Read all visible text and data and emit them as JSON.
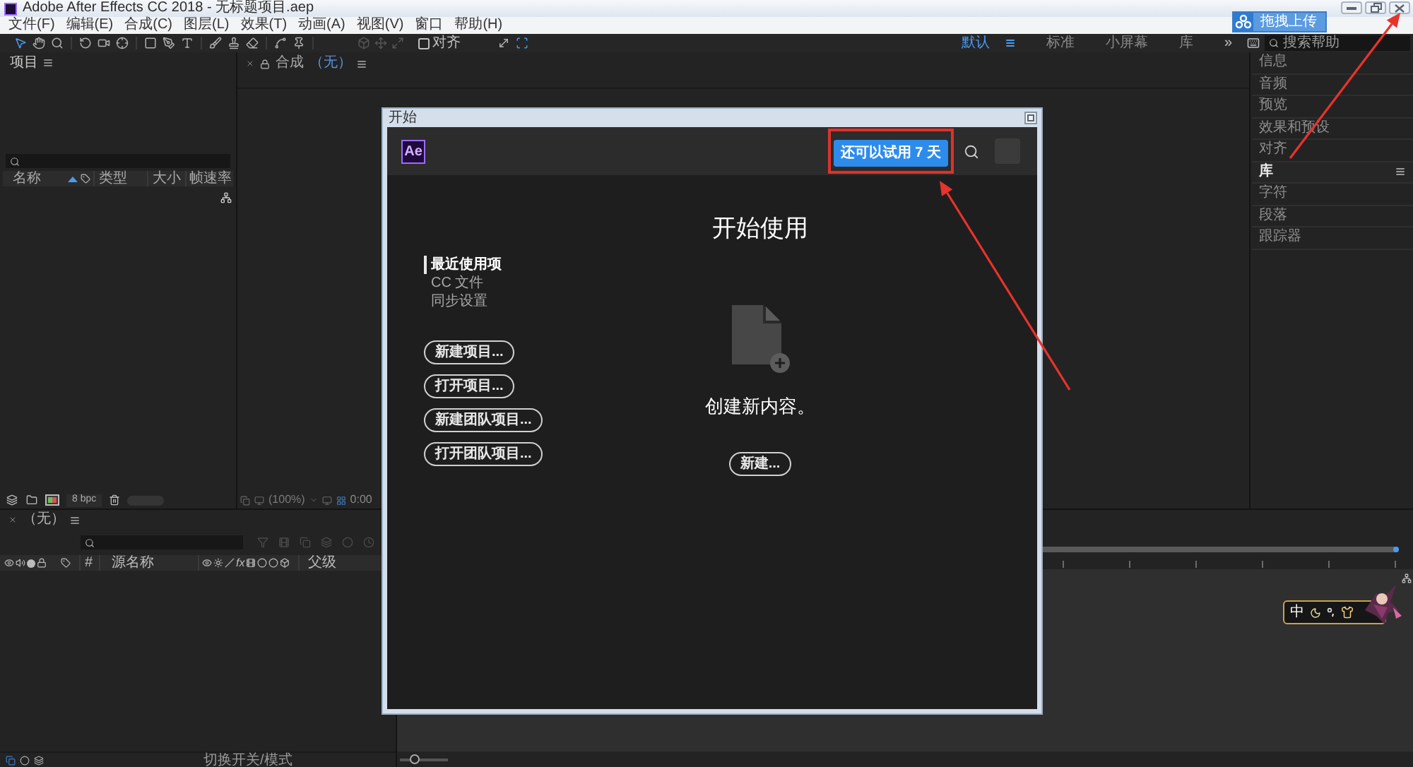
{
  "window": {
    "title": "Adobe After Effects CC 2018 - 无标题项目.aep"
  },
  "menu": [
    "文件(F)",
    "编辑(E)",
    "合成(C)",
    "图层(L)",
    "效果(T)",
    "动画(A)",
    "视图(V)",
    "窗口",
    "帮助(H)"
  ],
  "upload_overlay": {
    "label": "拖拽上传"
  },
  "toolbar": {
    "snap": {
      "label": "对齐",
      "checked": false
    },
    "workspaces": [
      {
        "label": "默认",
        "selected": true
      },
      {
        "label": "标准",
        "selected": false
      },
      {
        "label": "小屏幕",
        "selected": false
      },
      {
        "label": "库",
        "selected": false
      }
    ],
    "overflow": "»",
    "help_search": {
      "placeholder": "搜索帮助"
    }
  },
  "project_panel": {
    "title": "项目",
    "columns": [
      "名称",
      "类型",
      "大小",
      "帧速率"
    ],
    "bit_depth": "8 bpc"
  },
  "composition_panel": {
    "title": "合成",
    "comp_name": "（无）",
    "zoom": "(100%)",
    "timecode": "0:00"
  },
  "side_panels": [
    {
      "label": "信息",
      "selected": false
    },
    {
      "label": "音频",
      "selected": false
    },
    {
      "label": "预览",
      "selected": false
    },
    {
      "label": "效果和预设",
      "selected": false
    },
    {
      "label": "对齐",
      "selected": false
    },
    {
      "label": "库",
      "selected": true
    },
    {
      "label": "字符",
      "selected": false
    },
    {
      "label": "段落",
      "selected": false
    },
    {
      "label": "跟踪器",
      "selected": false
    }
  ],
  "timeline": {
    "comp_name": "（无）",
    "columns": [
      "#",
      "源名称",
      "父级"
    ],
    "fx_label": "fx",
    "mode_toggle": "切换开关/模式",
    "zoom_slider": {
      "level": 0.3
    }
  },
  "start_dialog": {
    "title": "开始",
    "logo": "Ae",
    "trial_button": "还可以试用 7 天",
    "heading": "开始使用",
    "nav": [
      {
        "label": "最近使用项",
        "selected": true
      },
      {
        "label": "CC 文件",
        "selected": false
      },
      {
        "label": "同步设置",
        "selected": false
      }
    ],
    "actions": [
      "新建项目...",
      "打开项目...",
      "新建团队项目...",
      "打开团队项目..."
    ],
    "empty_message": "创建新内容。",
    "new_button": "新建..."
  },
  "ime_toolbar": {
    "mode": "中"
  }
}
